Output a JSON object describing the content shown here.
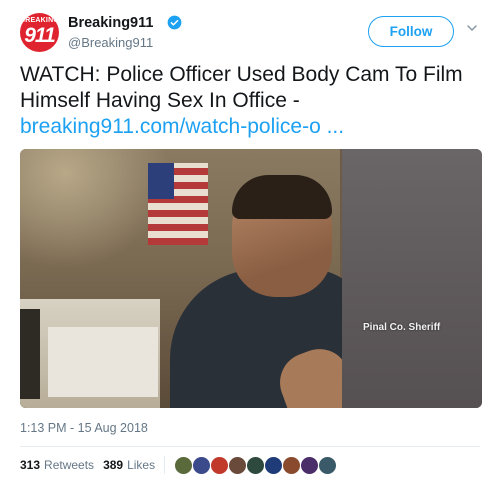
{
  "user": {
    "display_name": "Breaking911",
    "handle": "@Breaking911",
    "avatar_top_text": "BREAKING",
    "avatar_number": "911",
    "verified": true
  },
  "header": {
    "follow_label": "Follow",
    "menu_icon": "chevron-down-icon"
  },
  "tweet": {
    "text": "WATCH: Police Officer Used Body Cam To Film Himself Having Sex In Office - ",
    "link": "breaking911.com/watch-police-o  ..."
  },
  "media": {
    "watermark": "Pinal Co. Sheriff"
  },
  "meta": {
    "timestamp": "1:13 PM - 15 Aug 2018"
  },
  "stats": {
    "retweets_count": "313",
    "retweets_label": "Retweets",
    "likes_count": "389",
    "likes_label": "Likes"
  },
  "likers": [
    {
      "name": "liker-avatar-1",
      "color": "#5a6a3a"
    },
    {
      "name": "liker-avatar-2",
      "color": "#3b4a8a"
    },
    {
      "name": "liker-avatar-3",
      "color": "#c0392b"
    },
    {
      "name": "liker-avatar-4",
      "color": "#6a4a3a"
    },
    {
      "name": "liker-avatar-5",
      "color": "#2e4a3e"
    },
    {
      "name": "liker-avatar-6",
      "color": "#1f3b78"
    },
    {
      "name": "liker-avatar-7",
      "color": "#8a4a2e"
    },
    {
      "name": "liker-avatar-8",
      "color": "#4a2e6a"
    },
    {
      "name": "liker-avatar-9",
      "color": "#3a5a6a"
    }
  ],
  "colors": {
    "accent": "#1da1f2",
    "text_primary": "#14171a",
    "text_secondary": "#657786",
    "brand_red": "#e0242f"
  }
}
